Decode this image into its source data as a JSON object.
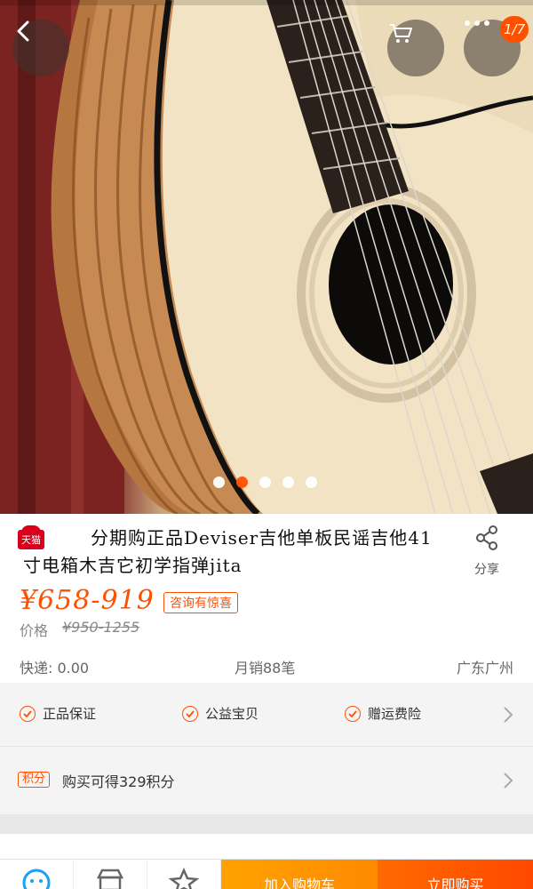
{
  "header": {
    "cart_badge": "1/7"
  },
  "gallery": {
    "image_alt": "acoustic guitar product photo",
    "dots_total": 5,
    "active_dot": 1
  },
  "product": {
    "store_badge": "天猫",
    "title": "分期购正品Deviser吉他单板民谣吉他41寸电箱木吉它初学指弹jita",
    "share_label": "分享",
    "price": "¥658-919",
    "promo_tag": "咨询有惊喜",
    "original_price_label": "价格",
    "original_price": "¥950-1255",
    "shipping": "快递: 0.00",
    "monthly_sales": "月销88笔",
    "location": "广东广州"
  },
  "guarantees": [
    {
      "label": "正品保证"
    },
    {
      "label": "公益宝贝"
    },
    {
      "label": "赠运费险"
    }
  ],
  "points": {
    "tag": "积分",
    "text": "购买可得329积分"
  },
  "bottom_bar": {
    "add_to_cart": "加入购物车",
    "buy_now": "立即购买"
  },
  "colors": {
    "accent": "#ff5000",
    "cart_button": "#ffa200",
    "buy_button": "#ff4800"
  }
}
